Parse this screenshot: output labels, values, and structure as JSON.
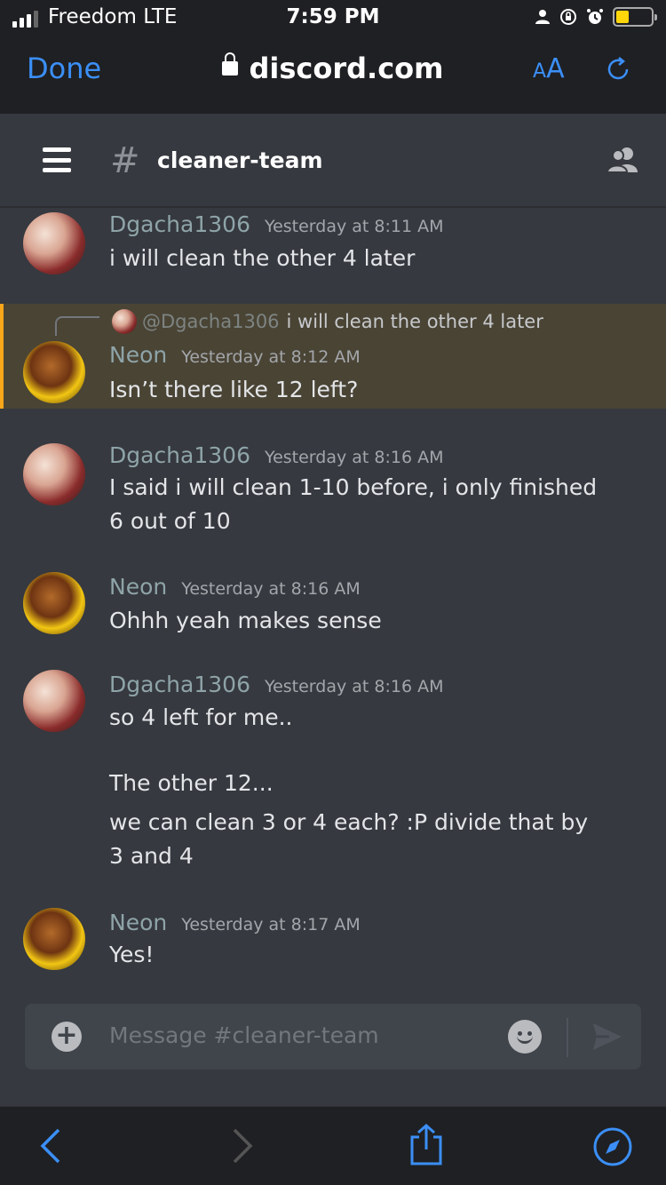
{
  "status_bar": {
    "carrier": "Freedom  LTE",
    "time": "7:59 PM"
  },
  "browser": {
    "done_label": "Done",
    "url": "discord.com",
    "text_size_label_small": "A",
    "text_size_label_large": "A"
  },
  "channel": {
    "hash": "#",
    "name": "cleaner-team"
  },
  "messages": [
    {
      "author": "Dgacha1306",
      "timestamp": "Yesterday at 8:11 AM",
      "lines": [
        "i will clean the other 4 later"
      ]
    },
    {
      "author": "Neon",
      "timestamp": "Yesterday at 8:12 AM",
      "reply_to_author": "@Dgacha1306",
      "reply_to_text": "i will clean the other 4 later",
      "lines": [
        "Isn’t there like 12 left?"
      ],
      "mentioned": true
    },
    {
      "author": "Dgacha1306",
      "timestamp": "Yesterday at 8:16 AM",
      "lines": [
        "I said i will clean 1-10 before, i only finished 6 out of 10"
      ]
    },
    {
      "author": "Neon",
      "timestamp": "Yesterday at 8:16 AM",
      "lines": [
        "Ohhh yeah makes sense"
      ]
    },
    {
      "author": "Dgacha1306",
      "timestamp": "Yesterday at 8:16 AM",
      "lines": [
        "so 4 left for me..",
        "The other 12...",
        "we can clean 3 or 4 each? :P divide that by 3 and 4"
      ]
    },
    {
      "author": "Neon",
      "timestamp": "Yesterday at 8:17 AM",
      "lines": [
        "Yes!"
      ]
    }
  ],
  "composer": {
    "placeholder": "Message #cleaner-team"
  },
  "colors": {
    "accent_blue": "#3b8ff7",
    "mention_bar": "#faa61a",
    "background": "#36393f"
  }
}
